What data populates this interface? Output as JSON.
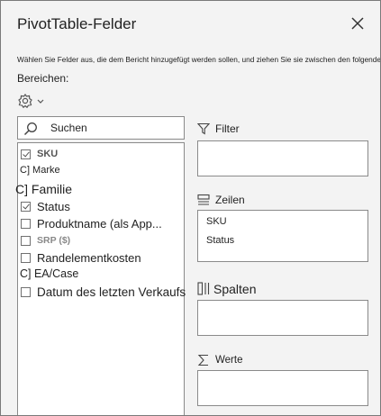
{
  "panel": {
    "title": "PivotTable-Felder",
    "description": "Wählen Sie Felder aus, die dem Bericht hinzugefügt werden sollen, und ziehen Sie sie zwischen den folgenden",
    "areas_label": "Bereichen:"
  },
  "search": {
    "placeholder": "Suchen",
    "icon": "search-icon"
  },
  "fields": [
    {
      "label": "SKU",
      "checked": true
    },
    {
      "label": "C] Marke",
      "checked": false
    },
    {
      "label": "C] Familie",
      "checked": false
    },
    {
      "label": "Status",
      "checked": true
    },
    {
      "label": "Produktname (als App...",
      "checked": false
    },
    {
      "label": "SRP ($)",
      "checked": false
    },
    {
      "label": "Randelementkosten",
      "checked": false
    },
    {
      "label": "C] EA/Case",
      "checked": false
    },
    {
      "label": "Datum des letzten Verkaufs",
      "checked": false
    }
  ],
  "areas": {
    "filter": {
      "label": "Filter",
      "icon": "filter-icon",
      "items": []
    },
    "rows": {
      "label": "Zeilen",
      "icon": "rows-icon",
      "items": [
        "SKU",
        "Status"
      ]
    },
    "columns": {
      "label": "Spalten",
      "icon": "columns-icon",
      "items": []
    },
    "values": {
      "label": "Werte",
      "icon": "sigma-icon",
      "items": []
    }
  }
}
